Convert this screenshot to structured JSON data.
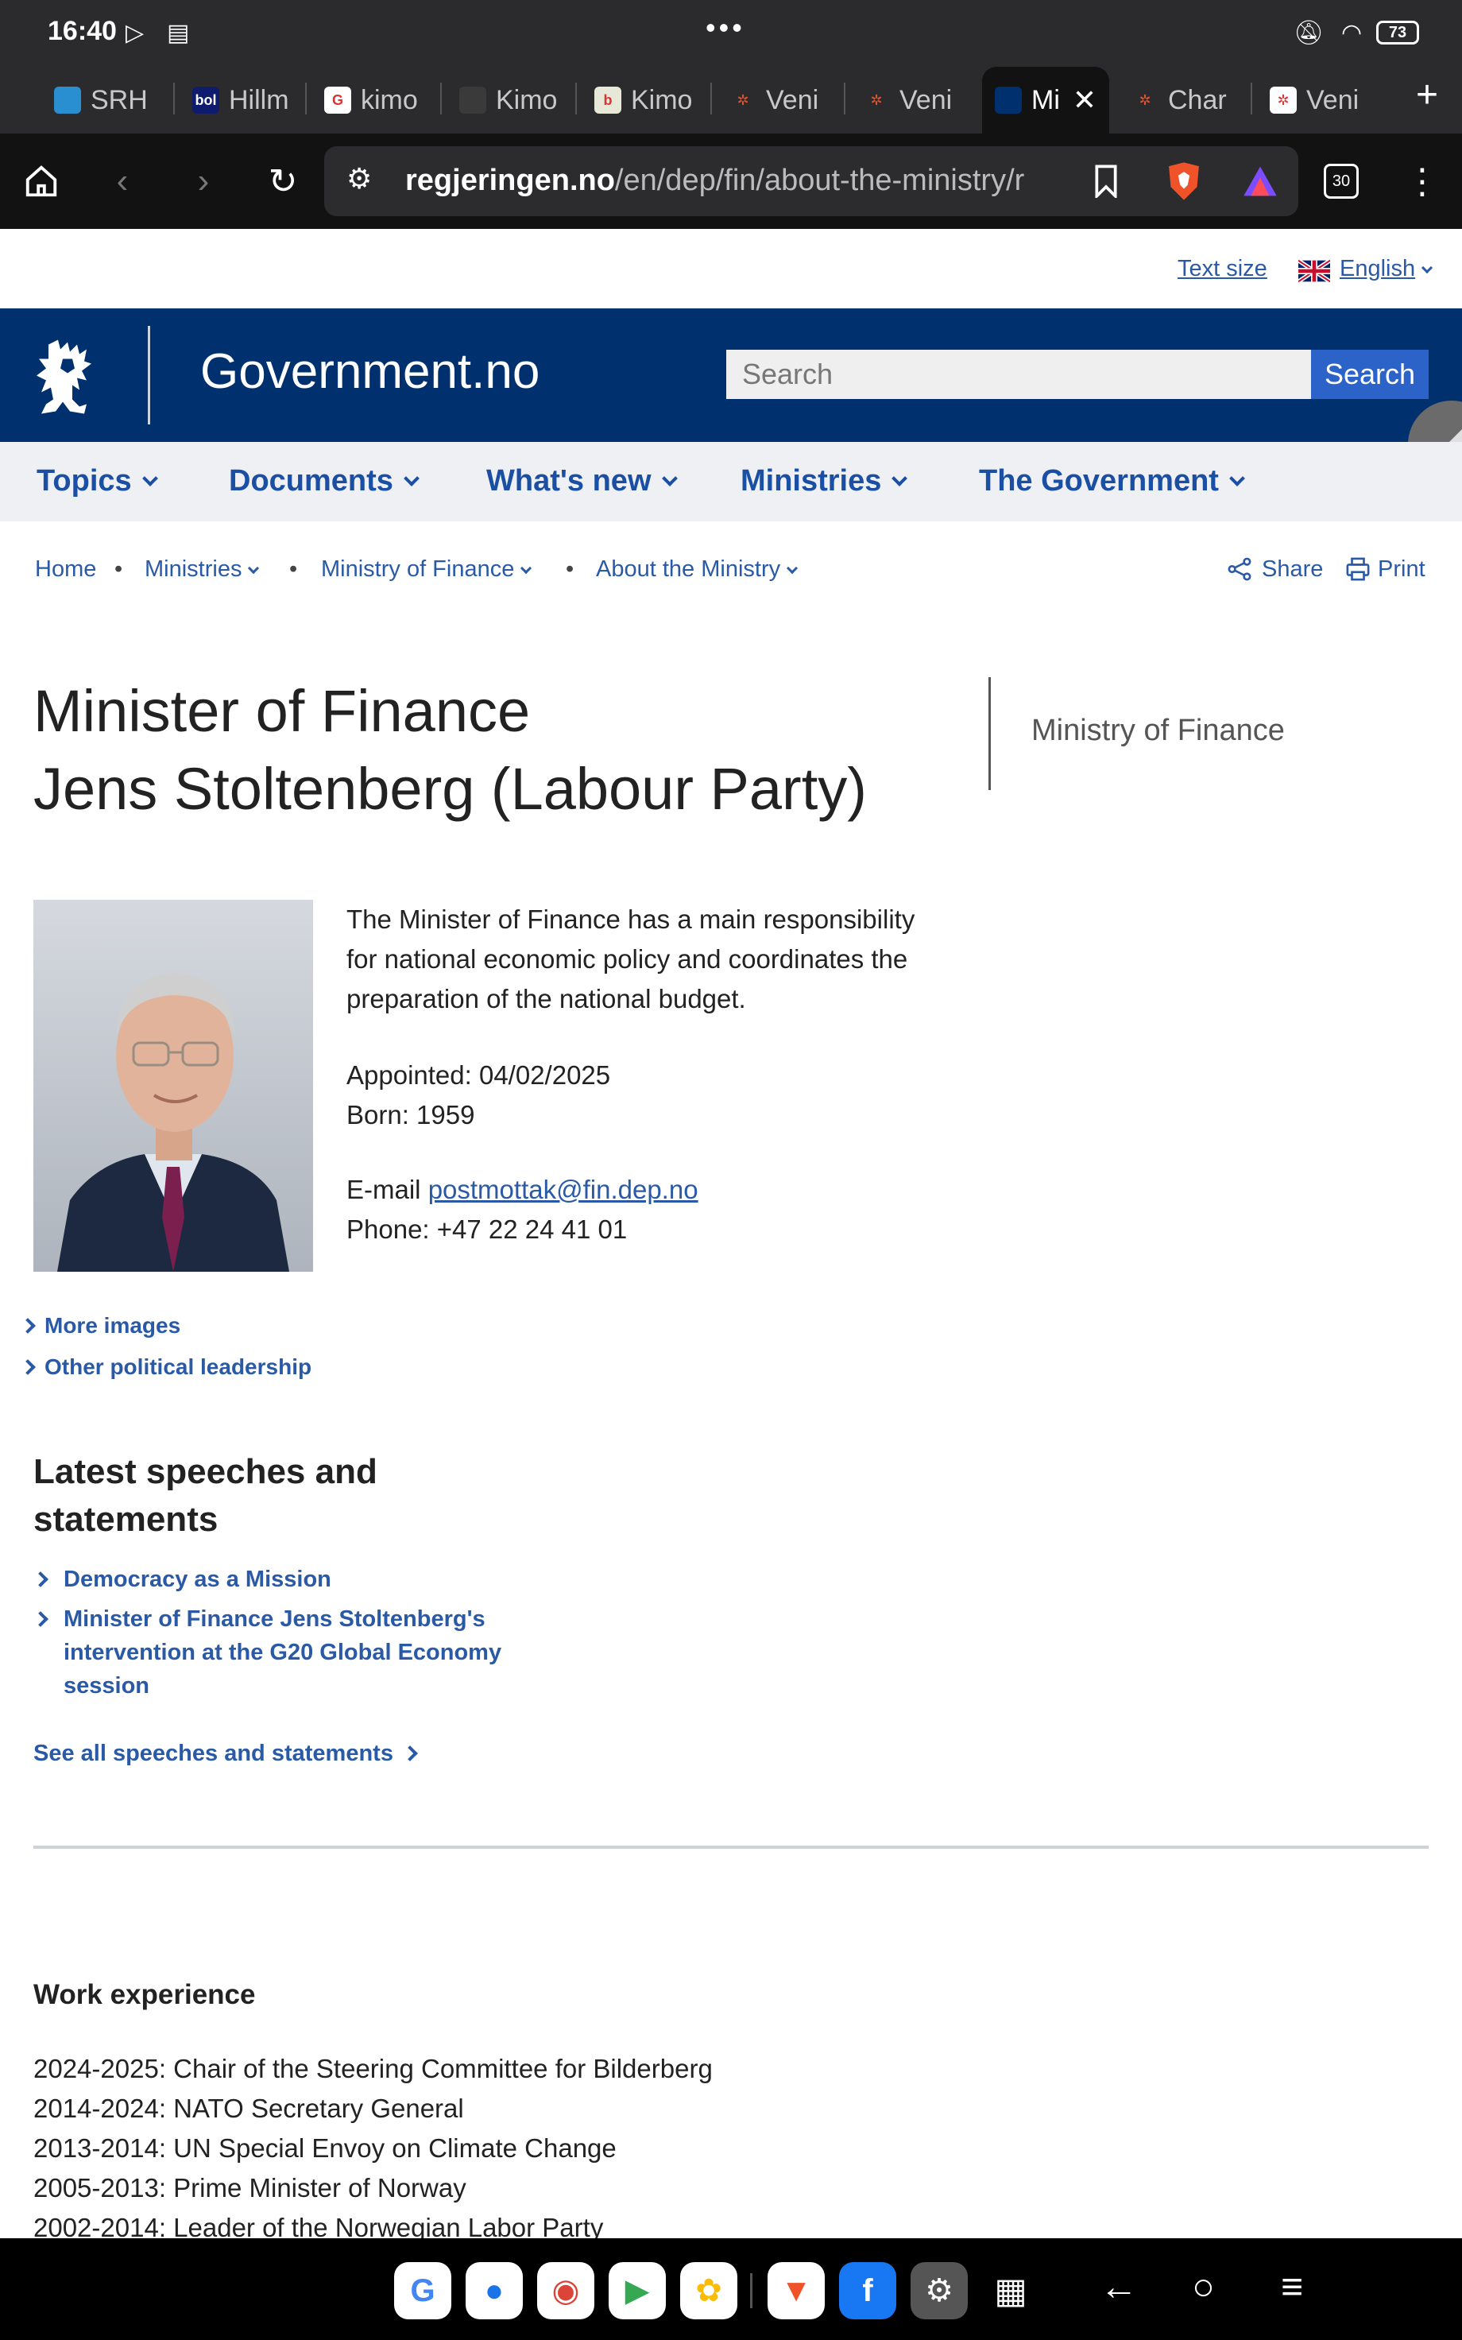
{
  "status_bar": {
    "time": "16:40",
    "battery": "73"
  },
  "tabs": [
    {
      "label": "SRH",
      "fav_color": "#2a8fd0",
      "fav_text": ""
    },
    {
      "label": "Hillm",
      "fav_color": "#0f1c6e",
      "fav_text": "bol"
    },
    {
      "label": "kimo",
      "fav_color": "#ffffff",
      "fav_text": "G"
    },
    {
      "label": "Kimo",
      "fav_color": "#3a3a3a",
      "fav_text": ""
    },
    {
      "label": "Kimo",
      "fav_color": "#e8e8d8",
      "fav_text": "b"
    },
    {
      "label": "Veni",
      "fav_color": "#2b2b2e",
      "fav_text": "✲"
    },
    {
      "label": "Veni",
      "fav_color": "#2b2b2e",
      "fav_text": "✲"
    },
    {
      "label": "Mi",
      "fav_color": "#00306e",
      "fav_text": ""
    },
    {
      "label": "Char",
      "fav_color": "#2b2b2e",
      "fav_text": "✲"
    },
    {
      "label": "Veni",
      "fav_color": "#ffffff",
      "fav_text": "✲"
    }
  ],
  "url": {
    "domain": "regjeringen.no",
    "path": "/en/dep/fin/about-the-ministry/r"
  },
  "tab_count": "30",
  "utility": {
    "text_size": "Text size",
    "language": "English"
  },
  "header": {
    "site_title": "Government.no",
    "search_placeholder": "Search",
    "search_button": "Search"
  },
  "nav": [
    "Topics",
    "Documents",
    "What's new",
    "Ministries",
    "The Government"
  ],
  "breadcrumb": [
    "Home",
    "Ministries",
    "Ministry of Finance",
    "About the Ministry"
  ],
  "share": "Share",
  "print": "Print",
  "title": {
    "line1": "Minister of Finance",
    "line2": "Jens Stoltenberg (Labour Party)"
  },
  "side_org": "Ministry of Finance",
  "bio": {
    "desc_lines": [
      "The Minister of Finance has a main responsibility",
      "for national economic policy and coordinates the",
      "preparation of the national budget."
    ],
    "appointed": "Appointed: 04/02/2025",
    "born": "Born: 1959",
    "email_label": "E-mail ",
    "email": "postmottak@fin.dep.no",
    "phone": "Phone: +47 22 24 41 01"
  },
  "links": {
    "more_images": "More images",
    "other_leadership": "Other political leadership"
  },
  "speeches": {
    "heading_l1": "Latest speeches and",
    "heading_l2": "statements",
    "items": [
      "Democracy as a Mission",
      "Minister of Finance Jens Stoltenberg's intervention at the G20 Global Economy session"
    ],
    "see_all": "See all speeches and statements"
  },
  "work": {
    "heading": "Work experience",
    "items": [
      "2024-2025: Chair of the Steering Committee for Bilderberg",
      "2014-2024: NATO Secretary General",
      "2013-2014: UN Special Envoy on Climate Change",
      "2005-2013: Prime Minister of Norway",
      "2002-2014: Leader of the Norwegian Labor Party"
    ]
  },
  "colors": {
    "header_bg": "#00306e",
    "link": "#2a5aa6",
    "search_btn": "#2c63c8",
    "nav_bg": "#eef0f4"
  }
}
